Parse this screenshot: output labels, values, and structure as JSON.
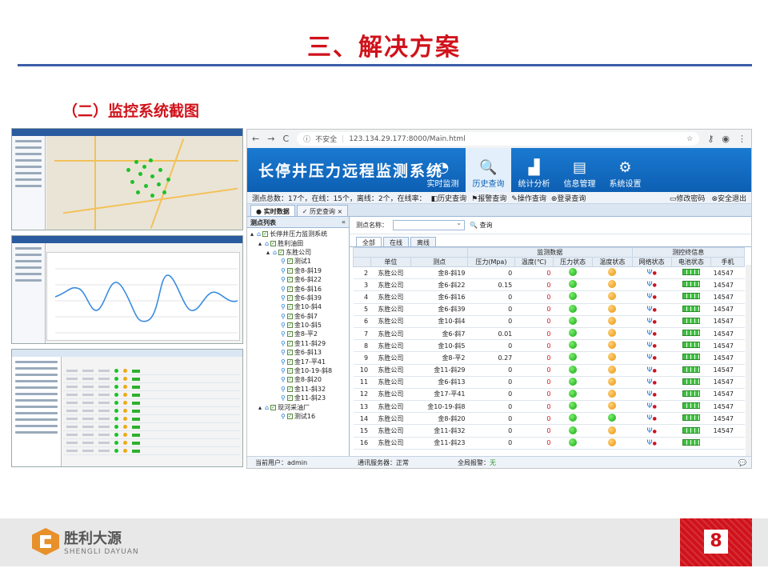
{
  "slide": {
    "title": "三、解决方案",
    "subtitle": "（二）监控系统截图",
    "page_number": "8"
  },
  "logo": {
    "cn": "胜利大源",
    "en": "SHENGLI DAYUAN"
  },
  "browser": {
    "url_security": "不安全",
    "url": "123.134.29.177:8000/Main.html"
  },
  "app": {
    "title": "长停井压力远程监测系统",
    "nav": [
      "实时监测",
      "历史查询",
      "统计分析",
      "信息管理",
      "系统设置"
    ],
    "nav_icons": [
      "gauge-icon",
      "search-doc-icon",
      "bar-chart-icon",
      "document-icon",
      "gear-icon"
    ],
    "status_text": "测点总数：17个，在线：15个，离线：2个，在线率：",
    "status_links": [
      "历史查询",
      "报警查询",
      "操作查询",
      "登录查询"
    ],
    "right_links": [
      "修改密码",
      "安全退出"
    ],
    "tabs": [
      "实时数据",
      "历史查询"
    ],
    "tree_title": "测点列表",
    "tree": [
      {
        "label": "长停井压力监测系统",
        "level": 0
      },
      {
        "label": "胜利油田",
        "level": 1
      },
      {
        "label": "东胜公司",
        "level": 2
      },
      {
        "label": "测试1",
        "level": 3
      },
      {
        "label": "金8-斜19",
        "level": 3
      },
      {
        "label": "金6-斜22",
        "level": 3
      },
      {
        "label": "金6-斜16",
        "level": 3
      },
      {
        "label": "金6-斜39",
        "level": 3
      },
      {
        "label": "金10-斜4",
        "level": 3
      },
      {
        "label": "金6-斜7",
        "level": 3
      },
      {
        "label": "金10-斜5",
        "level": 3
      },
      {
        "label": "金8-平2",
        "level": 3
      },
      {
        "label": "金11-斜29",
        "level": 3
      },
      {
        "label": "金6-斜13",
        "level": 3
      },
      {
        "label": "金17-平41",
        "level": 3
      },
      {
        "label": "金10-19-斜8",
        "level": 3
      },
      {
        "label": "金8-斜20",
        "level": 3
      },
      {
        "label": "金11-斜32",
        "level": 3
      },
      {
        "label": "金11-斜23",
        "level": 3
      },
      {
        "label": "现河采油厂",
        "level": 1
      },
      {
        "label": "测试16",
        "level": 3
      }
    ],
    "filter_label": "测点名称：",
    "query_button": "查询",
    "sub_tabs": [
      "全部",
      "在线",
      "离线"
    ],
    "group_headers": [
      "监测数据",
      "测控终信息"
    ],
    "columns": [
      "",
      "单位",
      "测点",
      "压力(Mpa)",
      "温度(℃)",
      "压力状态",
      "温度状态",
      "网络状态",
      "电池状态",
      "手机"
    ],
    "rows": [
      {
        "n": "2",
        "unit": "东胜公司",
        "point": "金8-斜19",
        "p": "0",
        "t": "0",
        "ps": "g",
        "ts": "o",
        "phone": "14547"
      },
      {
        "n": "3",
        "unit": "东胜公司",
        "point": "金6-斜22",
        "p": "0.15",
        "t": "0",
        "ps": "g",
        "ts": "o",
        "phone": "14547"
      },
      {
        "n": "4",
        "unit": "东胜公司",
        "point": "金6-斜16",
        "p": "0",
        "t": "0",
        "ps": "g",
        "ts": "o",
        "phone": "14547"
      },
      {
        "n": "5",
        "unit": "东胜公司",
        "point": "金6-斜39",
        "p": "0",
        "t": "0",
        "ps": "g",
        "ts": "o",
        "phone": "14547"
      },
      {
        "n": "6",
        "unit": "东胜公司",
        "point": "金10-斜4",
        "p": "0",
        "t": "0",
        "ps": "g",
        "ts": "o",
        "phone": "14547"
      },
      {
        "n": "7",
        "unit": "东胜公司",
        "point": "金6-斜7",
        "p": "0.01",
        "t": "0",
        "ps": "g",
        "ts": "o",
        "phone": "14547"
      },
      {
        "n": "8",
        "unit": "东胜公司",
        "point": "金10-斜5",
        "p": "0",
        "t": "0",
        "ps": "g",
        "ts": "o",
        "phone": "14547"
      },
      {
        "n": "9",
        "unit": "东胜公司",
        "point": "金8-平2",
        "p": "0.27",
        "t": "0",
        "ps": "g",
        "ts": "o",
        "phone": "14547"
      },
      {
        "n": "10",
        "unit": "东胜公司",
        "point": "金11-斜29",
        "p": "0",
        "t": "0",
        "ps": "g",
        "ts": "o",
        "phone": "14547"
      },
      {
        "n": "11",
        "unit": "东胜公司",
        "point": "金6-斜13",
        "p": "0",
        "t": "0",
        "ps": "g",
        "ts": "o",
        "phone": "14547"
      },
      {
        "n": "12",
        "unit": "东胜公司",
        "point": "金17-平41",
        "p": "0",
        "t": "0",
        "ps": "g",
        "ts": "o",
        "phone": "14547"
      },
      {
        "n": "13",
        "unit": "东胜公司",
        "point": "金10-19-斜8",
        "p": "0",
        "t": "0",
        "ps": "g",
        "ts": "o",
        "phone": "14547"
      },
      {
        "n": "14",
        "unit": "东胜公司",
        "point": "金8-斜20",
        "p": "0",
        "t": "0",
        "ps": "g",
        "ts": "g",
        "phone": "14547"
      },
      {
        "n": "15",
        "unit": "东胜公司",
        "point": "金11-斜32",
        "p": "0",
        "t": "0",
        "ps": "g",
        "ts": "o",
        "phone": "14547"
      },
      {
        "n": "16",
        "unit": "东胜公司",
        "point": "金11-斜23",
        "p": "0",
        "t": "0",
        "ps": "g",
        "ts": "o",
        "phone": ""
      }
    ],
    "footer": {
      "user": "当前用户：admin",
      "server": "通讯服务器：正常",
      "alarm_label": "全局报警：",
      "alarm_value": "无"
    }
  },
  "colors": {
    "accent_red": "#d0121b",
    "rule_blue": "#3a5ea8",
    "app_blue": "#1a7ad0"
  }
}
